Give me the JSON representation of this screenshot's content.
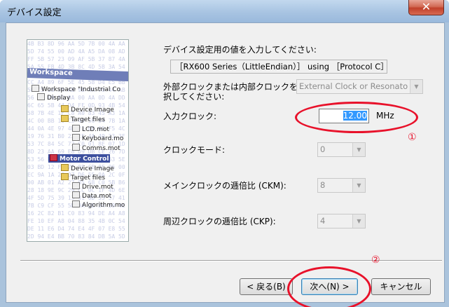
{
  "window": {
    "title": "デバイス設定",
    "close_glyph": "✕"
  },
  "illustration": {
    "hex_background": "4B B3 8D 96 AA 5D 7B 00 4A AA 5D 74 55 00 AD 4A A5 DA 08 AD FF 5B 57 23 09 AF 5B 37 87 4A 5A 55 FB 4D 3B 8C 4D 5B 3A 54 EE 65 5F 45 5A 7A 57 4A 5D 45 CC A4 89 6F 5E 45 58 D4 E5 BB 5D C5 38 7A AB 9B 4A 70 44 AB 56 13 69 8D 0A 00 AA 0D 4A DD 6C 65 5B 44 D4 FF 0D 93 4B 54 58 7B 4E 1F C8 A0 83 45 A3 1A 4C 00 BB 16 C3 4D 56 84 7B 1A 44 0A 4E 97 4B 21 BB 65 F5 4C 19 76 31 B0 22 EF 4A 49 33 3F 53 7C 84 5C 72 C0 01 8E 07 1D 8D 23 AA 69 E8 D9 DB CE 26 7D 53 56 D4 79 B4 23 18 10 63 5E 03 BD 12 FA 7F 8E CB 8F 06 00 EC 9A 1A 2C 07 D6 55 0A 2C 0F 00 AB 01 A2 27 05 68 C0 5B B6 28 18 9E 9C 29 CC 0C 1F 4D 6E 4F 5D 75 39 13 31 0D 55 57 41 7B C9 CF 55 5D 9A DE 24 59 4E 16 2C 82 B1 C0 83 94 DE A4 A8 FE 10 EF A8 04 88 35 4B 0C 54 DE 11 E6 D4 74 E4 4F 07 E8 55 2D 94 E4 BB 70 83 84 DB 5A 5D 9B 11 AA 3B 51 55 4D 45",
    "workspace_header": "Workspace",
    "tree": [
      {
        "label": "Workspace \"Industrial Co"
      },
      {
        "label": "Display"
      },
      {
        "label": "Device Image"
      },
      {
        "label": "Target files"
      },
      {
        "label": "LCD.mot"
      },
      {
        "label": "Keyboard.mo"
      },
      {
        "label": "Comms.mot"
      },
      {
        "label": "Motor Control"
      },
      {
        "label": "Device Image"
      },
      {
        "label": "Target files"
      },
      {
        "label": "Drive.mot"
      },
      {
        "label": "Data.mot"
      },
      {
        "label": "Algorithm.mo"
      }
    ]
  },
  "form": {
    "instruction": "デバイス設定用の値を入力してください:",
    "device_text": "［RX600 Series（LittleEndian）］ using ［Protocol C］",
    "clock_source_label_line1": "外部クロックまたは内部クロックを選",
    "clock_source_label_line2": "択してください:",
    "clock_source_value": "External Clock or Resonato",
    "input_clock_label": "入力クロック:",
    "input_clock_value": "12.00",
    "input_clock_unit": "MHz",
    "clock_mode_label": "クロックモード:",
    "clock_mode_value": "0",
    "main_ratio_label": "メインクロックの逓倍比 (CKM):",
    "main_ratio_value": "8",
    "peripheral_ratio_label": "周辺クロックの逓倍比 (CKP):",
    "peripheral_ratio_value": "4"
  },
  "buttons": {
    "back": "< 戻る(B)",
    "next": "次へ(N) >",
    "cancel": "キャンセル"
  },
  "annotations": {
    "marker1": "①",
    "marker2": "②",
    "color": "#e8112a"
  }
}
